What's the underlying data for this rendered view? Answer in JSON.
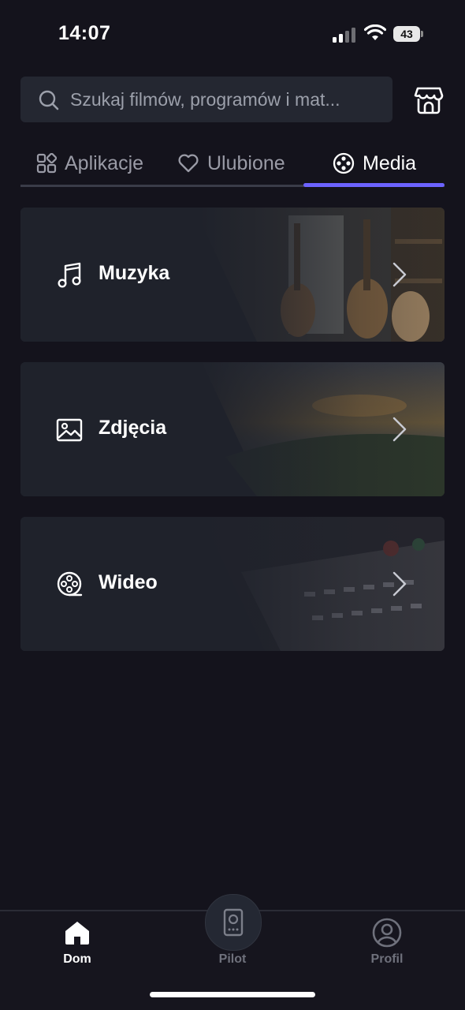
{
  "status_bar": {
    "time": "14:07",
    "battery": "43"
  },
  "search": {
    "placeholder": "Szukaj filmów, programów i mat..."
  },
  "tabs": [
    {
      "label": "Aplikacje",
      "icon": "apps-grid-icon",
      "active": false
    },
    {
      "label": "Ulubione",
      "icon": "heart-icon",
      "active": false
    },
    {
      "label": "Media",
      "icon": "film-reel-icon",
      "active": true
    }
  ],
  "media_cards": [
    {
      "label": "Muzyka",
      "icon": "music-note-icon"
    },
    {
      "label": "Zdjęcia",
      "icon": "image-icon"
    },
    {
      "label": "Wideo",
      "icon": "film-reel-icon"
    }
  ],
  "bottom_nav": {
    "items": [
      {
        "label": "Dom",
        "icon": "home-icon",
        "active": true
      },
      {
        "label": "Pilot",
        "icon": "remote-icon",
        "active": false
      },
      {
        "label": "Profil",
        "icon": "profile-icon",
        "active": false
      }
    ]
  },
  "colors": {
    "background": "#14131c",
    "accent": "#6c63ff",
    "inactive_text": "#9a9ba6",
    "search_background": "#242731"
  }
}
